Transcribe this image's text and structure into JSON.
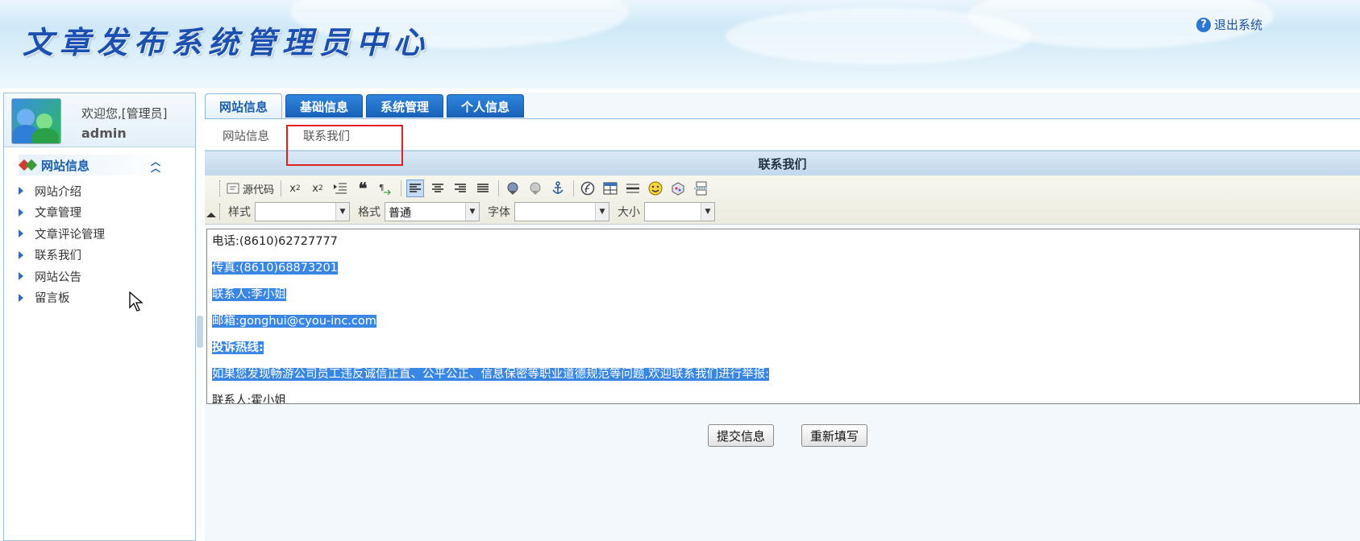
{
  "header": {
    "title": "文章发布系统管理员中心",
    "logout_label": "退出系统"
  },
  "user": {
    "welcome": "欢迎您,[管理员]",
    "name": "admin"
  },
  "menu": {
    "group_title": "网站信息",
    "items": [
      {
        "label": "网站介绍"
      },
      {
        "label": "文章管理"
      },
      {
        "label": "文章评论管理"
      },
      {
        "label": "联系我们"
      },
      {
        "label": "网站公告"
      },
      {
        "label": "留言板"
      }
    ]
  },
  "tabs": [
    {
      "label": "网站信息",
      "active": true
    },
    {
      "label": "基础信息"
    },
    {
      "label": "系统管理"
    },
    {
      "label": "个人信息"
    }
  ],
  "breadcrumb": {
    "item1": "网站信息",
    "separator": "·",
    "item2": "联系我们"
  },
  "panel_title": "联系我们",
  "toolbar": {
    "source_label": "源代码",
    "style_label": "样式",
    "style_value": "",
    "format_label": "格式",
    "format_value": "普通",
    "font_label": "字体",
    "font_value": "",
    "size_label": "大小",
    "size_value": ""
  },
  "editor": {
    "lines": [
      "电话:(8610)62727777",
      "传真:(8610)68873201",
      "联系人:李小姐",
      "邮箱:gonghui@cyou-inc.com",
      "投诉热线:",
      "如果您发现畅游公司员工违反诚信正直、公平公正、信息保密等职业道德规范等问题,欢迎联系我们进行举报:",
      "联系人:霍小姐"
    ]
  },
  "actions": {
    "submit_label": "提交信息",
    "reset_label": "重新填写"
  },
  "colors": {
    "tab_blue": "#1f6fc8",
    "selection": "#3a86e5",
    "highlight_box": "#e0201c"
  }
}
